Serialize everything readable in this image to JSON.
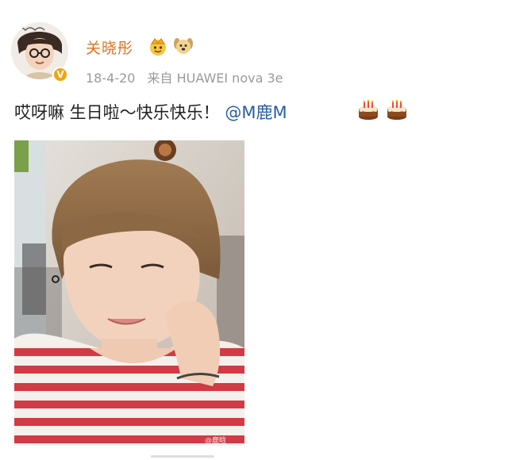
{
  "post": {
    "author": {
      "name": "关晓彤",
      "avatar_icon": "user-avatar-icon",
      "verified_icon": "verified-badge-icon",
      "badges": [
        "vip-crown-icon",
        "puppy-face-icon"
      ]
    },
    "meta": {
      "date": "18-4-20",
      "source": "来自 HUAWEI nova 3e"
    },
    "content": {
      "text": "哎呀嘛 生日啦～快乐快乐！",
      "mention": "@M鹿M",
      "emojis": [
        "birthday-cake-icon",
        "birthday-cake-icon"
      ]
    },
    "image": {
      "subject": "photo-icon",
      "watermark": "@鹿晗"
    }
  },
  "colors": {
    "username": "#e0701f",
    "mention": "#2a5d9c",
    "meta": "#9a9a9a",
    "text": "#222222",
    "verified": "#f3a20f"
  }
}
